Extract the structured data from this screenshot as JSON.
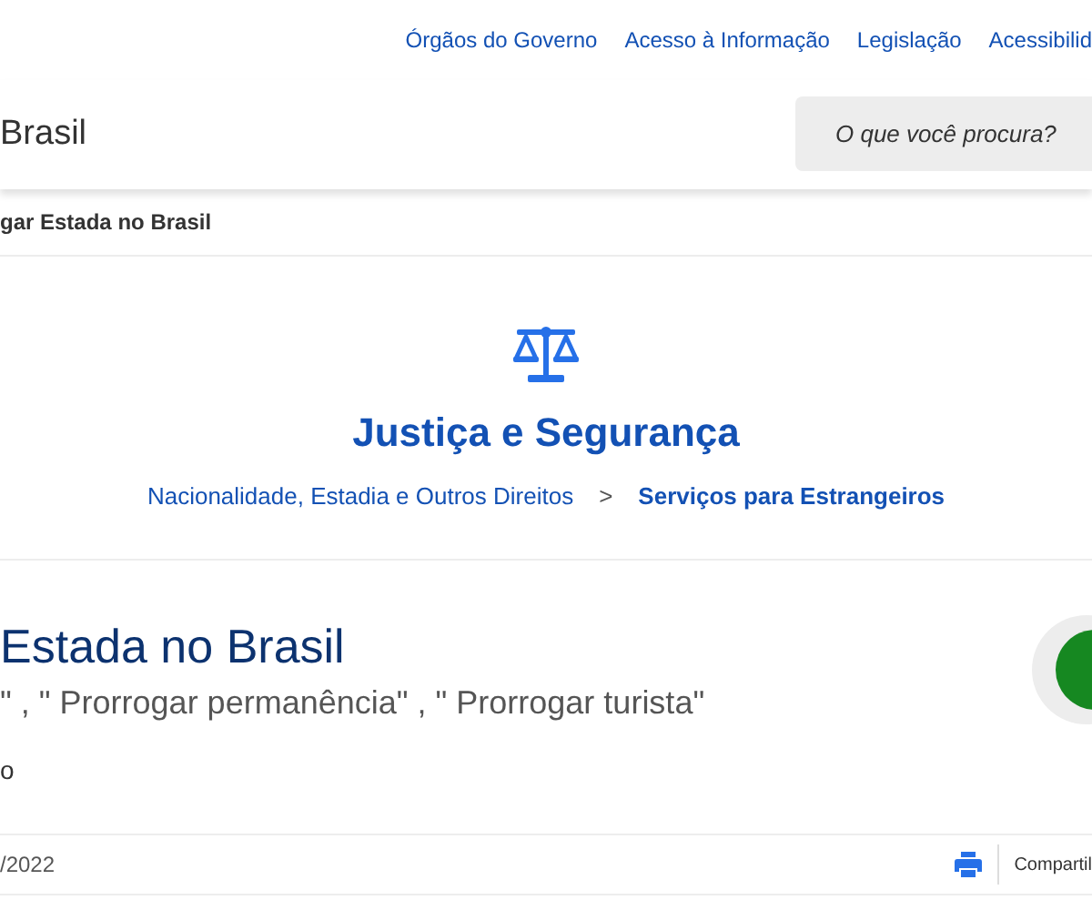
{
  "top_links": [
    "Órgãos do Governo",
    "Acesso à Informação",
    "Legislação",
    "Acessibilid"
  ],
  "header": {
    "site_title": "Brasil",
    "search": {
      "placeholder": "O que você procura?"
    }
  },
  "breadcrumb_current": "gar Estada no Brasil",
  "category": {
    "title": "Justiça e Segurança",
    "separator": ">",
    "breadcrumb": [
      {
        "label": "Nacionalidade, Estadia e Outros Direitos",
        "current": false
      },
      {
        "label": "Serviços para Estrangeiros",
        "current": true
      }
    ]
  },
  "service": {
    "title": "Estada no Brasil",
    "aliases": "\" , \" Prorrogar permanência\" , \" Prorrogar turista\"",
    "line_3": "o"
  },
  "footer_bar": {
    "date": "/2022",
    "share_label": "Compartil"
  }
}
